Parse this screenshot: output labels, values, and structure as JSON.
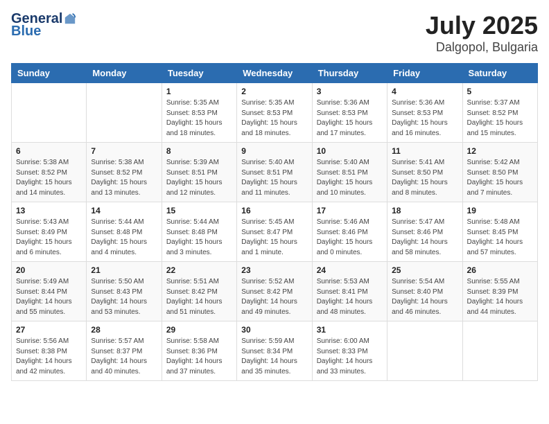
{
  "header": {
    "logo_general": "General",
    "logo_blue": "Blue",
    "title": "July 2025",
    "subtitle": "Dalgopol, Bulgaria"
  },
  "weekdays": [
    "Sunday",
    "Monday",
    "Tuesday",
    "Wednesday",
    "Thursday",
    "Friday",
    "Saturday"
  ],
  "weeks": [
    [
      {
        "day": "",
        "info": ""
      },
      {
        "day": "",
        "info": ""
      },
      {
        "day": "1",
        "info": "Sunrise: 5:35 AM\nSunset: 8:53 PM\nDaylight: 15 hours\nand 18 minutes."
      },
      {
        "day": "2",
        "info": "Sunrise: 5:35 AM\nSunset: 8:53 PM\nDaylight: 15 hours\nand 18 minutes."
      },
      {
        "day": "3",
        "info": "Sunrise: 5:36 AM\nSunset: 8:53 PM\nDaylight: 15 hours\nand 17 minutes."
      },
      {
        "day": "4",
        "info": "Sunrise: 5:36 AM\nSunset: 8:53 PM\nDaylight: 15 hours\nand 16 minutes."
      },
      {
        "day": "5",
        "info": "Sunrise: 5:37 AM\nSunset: 8:52 PM\nDaylight: 15 hours\nand 15 minutes."
      }
    ],
    [
      {
        "day": "6",
        "info": "Sunrise: 5:38 AM\nSunset: 8:52 PM\nDaylight: 15 hours\nand 14 minutes."
      },
      {
        "day": "7",
        "info": "Sunrise: 5:38 AM\nSunset: 8:52 PM\nDaylight: 15 hours\nand 13 minutes."
      },
      {
        "day": "8",
        "info": "Sunrise: 5:39 AM\nSunset: 8:51 PM\nDaylight: 15 hours\nand 12 minutes."
      },
      {
        "day": "9",
        "info": "Sunrise: 5:40 AM\nSunset: 8:51 PM\nDaylight: 15 hours\nand 11 minutes."
      },
      {
        "day": "10",
        "info": "Sunrise: 5:40 AM\nSunset: 8:51 PM\nDaylight: 15 hours\nand 10 minutes."
      },
      {
        "day": "11",
        "info": "Sunrise: 5:41 AM\nSunset: 8:50 PM\nDaylight: 15 hours\nand 8 minutes."
      },
      {
        "day": "12",
        "info": "Sunrise: 5:42 AM\nSunset: 8:50 PM\nDaylight: 15 hours\nand 7 minutes."
      }
    ],
    [
      {
        "day": "13",
        "info": "Sunrise: 5:43 AM\nSunset: 8:49 PM\nDaylight: 15 hours\nand 6 minutes."
      },
      {
        "day": "14",
        "info": "Sunrise: 5:44 AM\nSunset: 8:48 PM\nDaylight: 15 hours\nand 4 minutes."
      },
      {
        "day": "15",
        "info": "Sunrise: 5:44 AM\nSunset: 8:48 PM\nDaylight: 15 hours\nand 3 minutes."
      },
      {
        "day": "16",
        "info": "Sunrise: 5:45 AM\nSunset: 8:47 PM\nDaylight: 15 hours\nand 1 minute."
      },
      {
        "day": "17",
        "info": "Sunrise: 5:46 AM\nSunset: 8:46 PM\nDaylight: 15 hours\nand 0 minutes."
      },
      {
        "day": "18",
        "info": "Sunrise: 5:47 AM\nSunset: 8:46 PM\nDaylight: 14 hours\nand 58 minutes."
      },
      {
        "day": "19",
        "info": "Sunrise: 5:48 AM\nSunset: 8:45 PM\nDaylight: 14 hours\nand 57 minutes."
      }
    ],
    [
      {
        "day": "20",
        "info": "Sunrise: 5:49 AM\nSunset: 8:44 PM\nDaylight: 14 hours\nand 55 minutes."
      },
      {
        "day": "21",
        "info": "Sunrise: 5:50 AM\nSunset: 8:43 PM\nDaylight: 14 hours\nand 53 minutes."
      },
      {
        "day": "22",
        "info": "Sunrise: 5:51 AM\nSunset: 8:42 PM\nDaylight: 14 hours\nand 51 minutes."
      },
      {
        "day": "23",
        "info": "Sunrise: 5:52 AM\nSunset: 8:42 PM\nDaylight: 14 hours\nand 49 minutes."
      },
      {
        "day": "24",
        "info": "Sunrise: 5:53 AM\nSunset: 8:41 PM\nDaylight: 14 hours\nand 48 minutes."
      },
      {
        "day": "25",
        "info": "Sunrise: 5:54 AM\nSunset: 8:40 PM\nDaylight: 14 hours\nand 46 minutes."
      },
      {
        "day": "26",
        "info": "Sunrise: 5:55 AM\nSunset: 8:39 PM\nDaylight: 14 hours\nand 44 minutes."
      }
    ],
    [
      {
        "day": "27",
        "info": "Sunrise: 5:56 AM\nSunset: 8:38 PM\nDaylight: 14 hours\nand 42 minutes."
      },
      {
        "day": "28",
        "info": "Sunrise: 5:57 AM\nSunset: 8:37 PM\nDaylight: 14 hours\nand 40 minutes."
      },
      {
        "day": "29",
        "info": "Sunrise: 5:58 AM\nSunset: 8:36 PM\nDaylight: 14 hours\nand 37 minutes."
      },
      {
        "day": "30",
        "info": "Sunrise: 5:59 AM\nSunset: 8:34 PM\nDaylight: 14 hours\nand 35 minutes."
      },
      {
        "day": "31",
        "info": "Sunrise: 6:00 AM\nSunset: 8:33 PM\nDaylight: 14 hours\nand 33 minutes."
      },
      {
        "day": "",
        "info": ""
      },
      {
        "day": "",
        "info": ""
      }
    ]
  ]
}
